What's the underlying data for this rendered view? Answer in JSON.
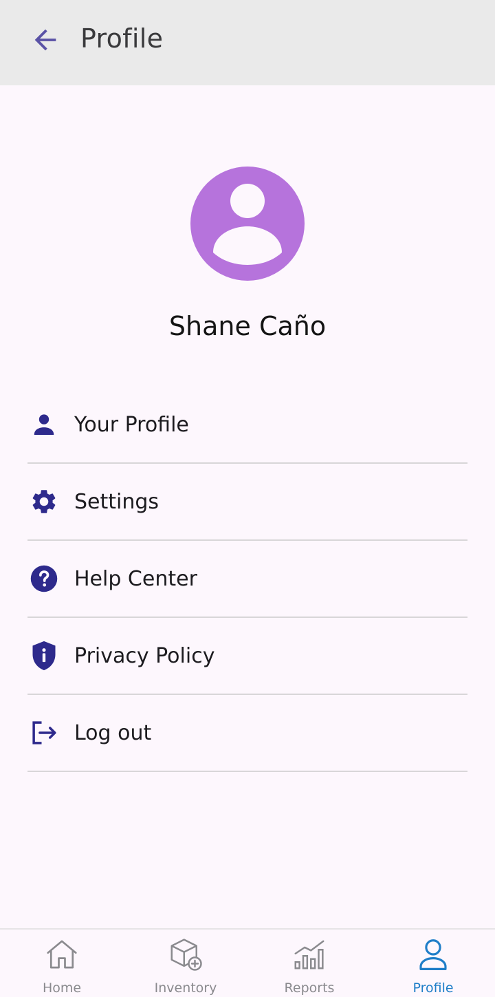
{
  "header": {
    "title": "Profile",
    "back_icon": "arrow-back-icon"
  },
  "profile": {
    "avatar_icon": "person-avatar-icon",
    "name": "Shane Caño"
  },
  "menu": {
    "items": [
      {
        "label": "Your Profile",
        "icon": "person-icon"
      },
      {
        "label": "Settings",
        "icon": "gear-icon"
      },
      {
        "label": "Help Center",
        "icon": "help-circle-icon"
      },
      {
        "label": "Privacy Policy",
        "icon": "shield-info-icon"
      },
      {
        "label": "Log out",
        "icon": "logout-icon"
      }
    ]
  },
  "bottom_nav": {
    "items": [
      {
        "label": "Home",
        "icon": "home-icon",
        "active": false
      },
      {
        "label": "Inventory",
        "icon": "box-add-icon",
        "active": false
      },
      {
        "label": "Reports",
        "icon": "bar-chart-icon",
        "active": false
      },
      {
        "label": "Profile",
        "icon": "person-outline-icon",
        "active": true
      }
    ]
  },
  "colors": {
    "header_bg": "#eaeaea",
    "page_bg": "#fdf7fd",
    "avatar": "#b673dc",
    "menu_icon": "#2e2a8c",
    "nav_active": "#1f7ec8",
    "nav_inactive": "#8a8a8e"
  }
}
